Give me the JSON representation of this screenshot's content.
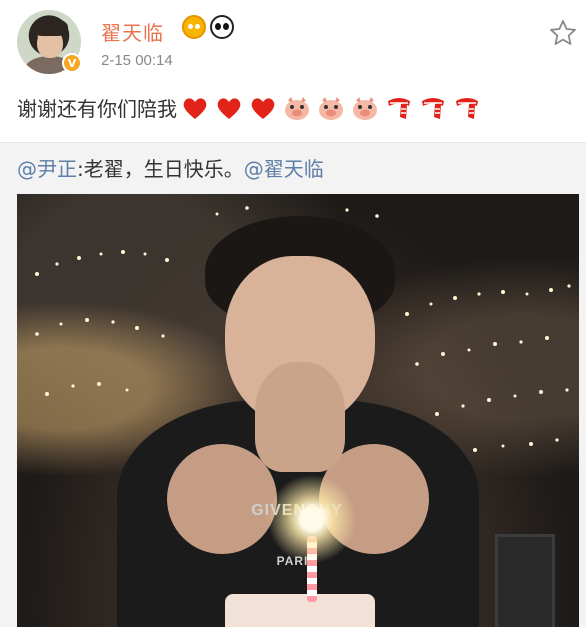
{
  "header": {
    "username": "翟天临",
    "timestamp": "2-15 00:14",
    "badges": [
      "crown-badge-icon",
      "panda-badge-icon"
    ],
    "avatar_icon": "avatar",
    "verify_icon": "verified-badge-icon",
    "verify_mark": "V"
  },
  "post": {
    "text": "谢谢还有你们陪我",
    "emojis": [
      "heart",
      "heart",
      "heart",
      "pig",
      "pig",
      "pig",
      "scarf",
      "scarf",
      "scarf"
    ]
  },
  "repost": {
    "mention_author": "@尹正",
    "body": ":老翟，生日快乐。",
    "mention_target": "@翟天临"
  },
  "photo": {
    "shirt_print_line1": "GIVENCHY",
    "shirt_print_line2": "PARIS"
  },
  "colors": {
    "username": "#eb7350",
    "mention": "#5d7fa8",
    "heart": "#e2231a",
    "repost_bg": "#f3f3f3"
  }
}
